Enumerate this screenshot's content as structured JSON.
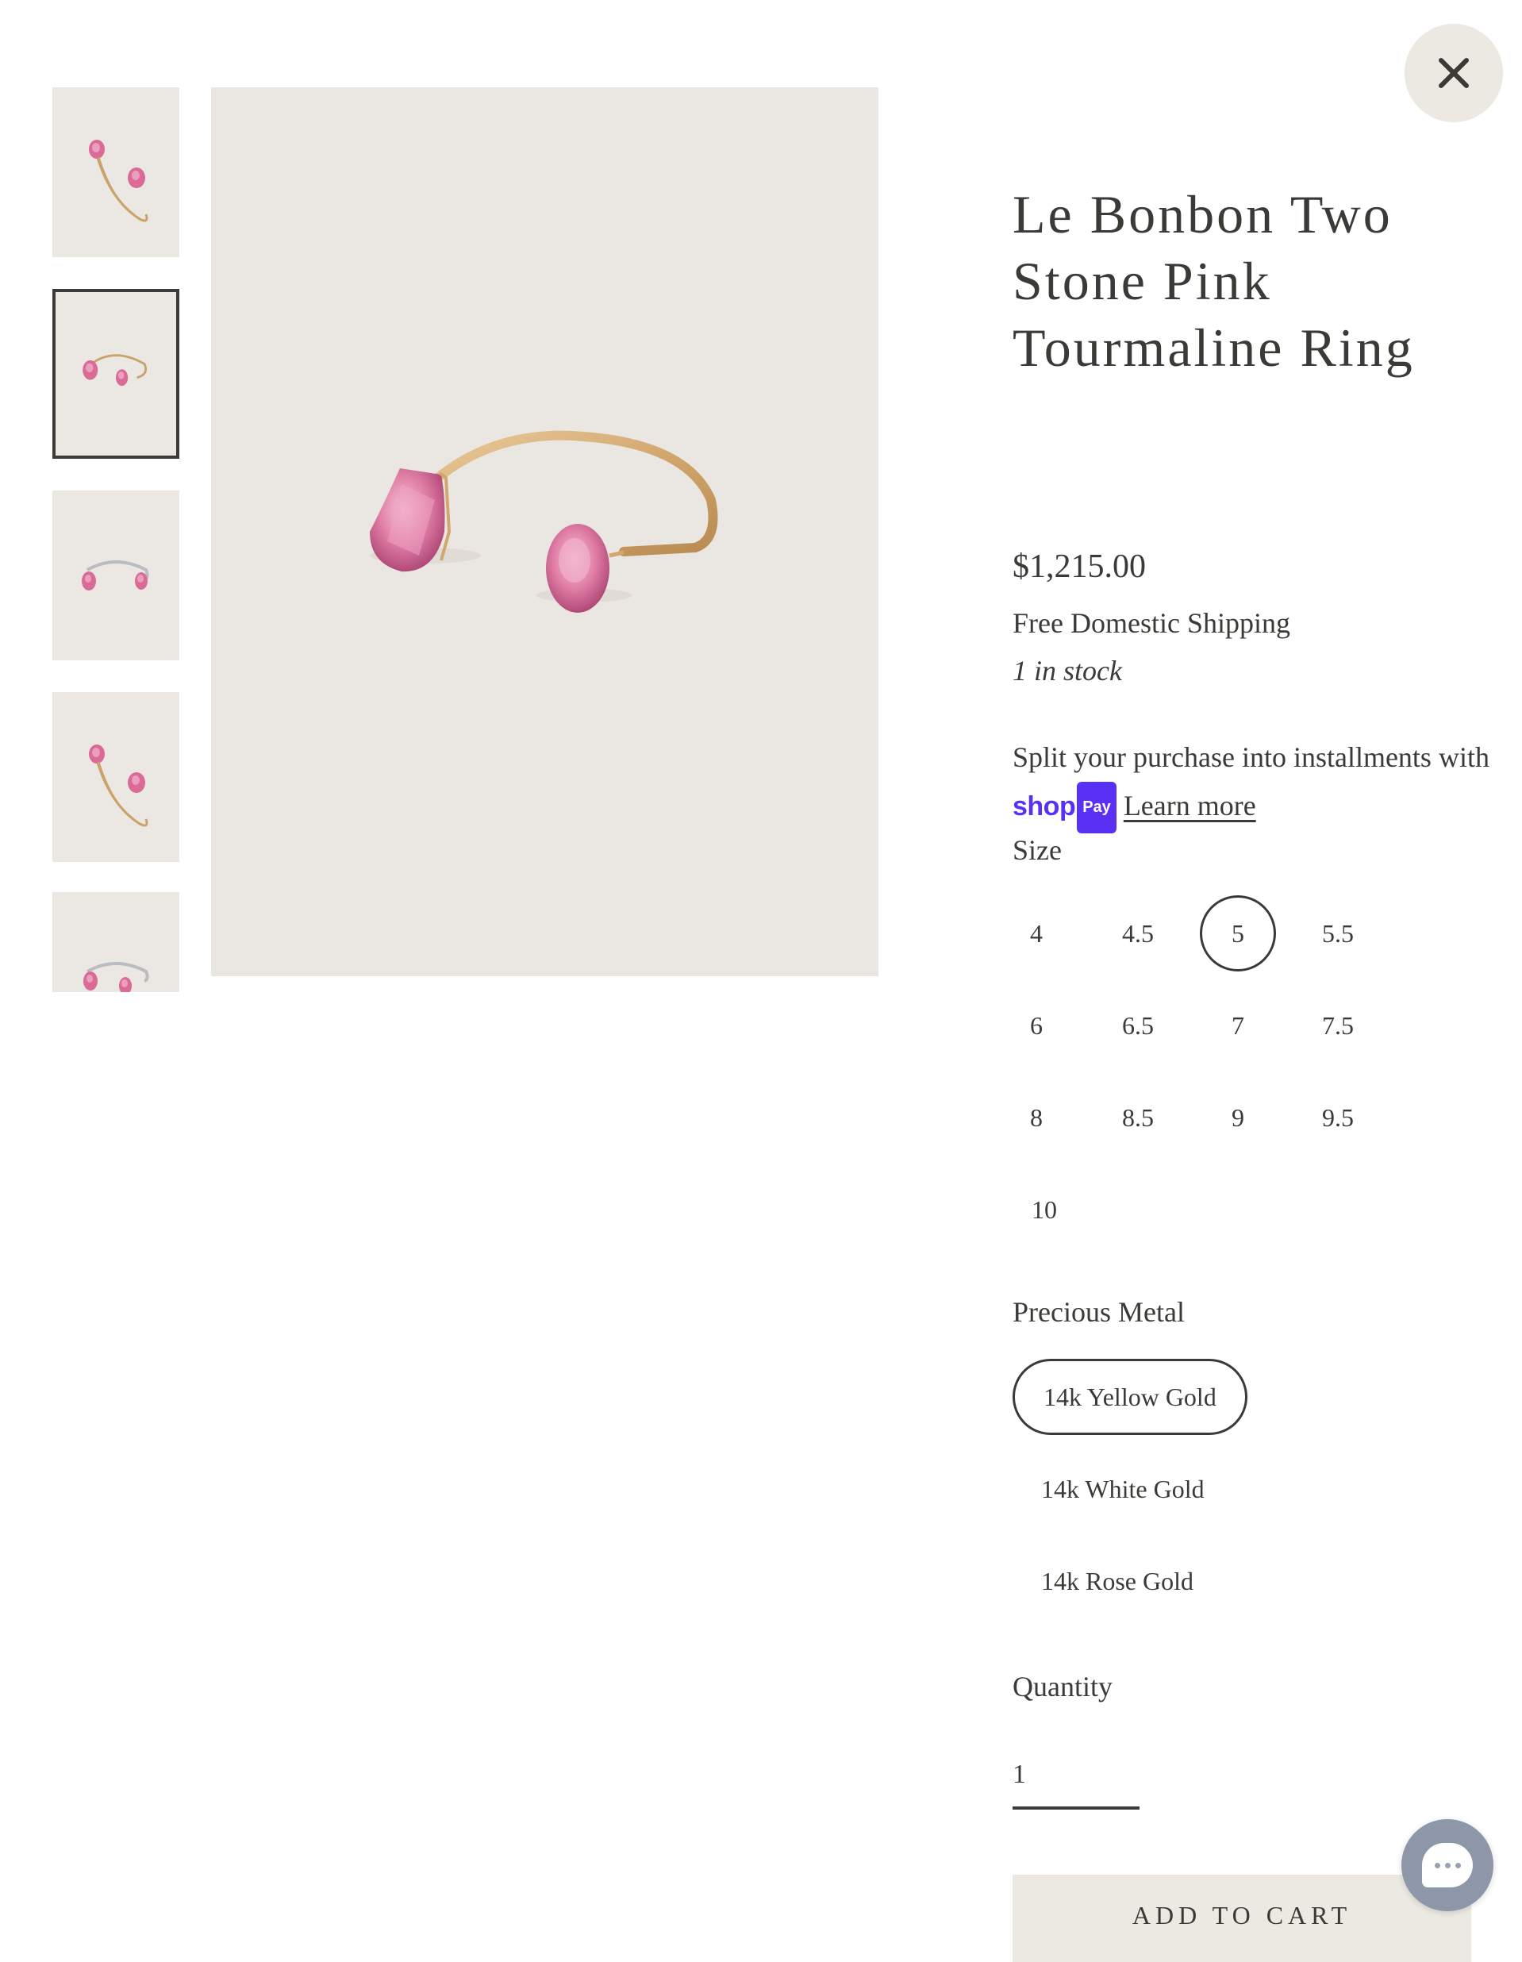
{
  "modal": {
    "close_icon": "close-x-icon"
  },
  "gallery": {
    "thumbnails": [
      {
        "name": "thumbnail-1",
        "metal": "yellow",
        "view": "side",
        "selected": false
      },
      {
        "name": "thumbnail-2",
        "metal": "yellow",
        "view": "front",
        "selected": true
      },
      {
        "name": "thumbnail-3",
        "metal": "white",
        "view": "front",
        "selected": false
      },
      {
        "name": "thumbnail-4",
        "metal": "yellow",
        "view": "side",
        "selected": false
      },
      {
        "name": "thumbnail-5",
        "metal": "white",
        "view": "front",
        "selected": false
      }
    ],
    "main_image": "ring-photo"
  },
  "product": {
    "title": "Le Bonbon Two Stone Pink Tourmaline Ring",
    "price": "$1,215.00",
    "shipping": "Free Domestic Shipping",
    "stock": "1 in stock",
    "installments_text": "Split your purchase into installments with",
    "shop_pay_brand": "shop",
    "shop_pay_badge": "Pay",
    "learn_more": "Learn more"
  },
  "size": {
    "label": "Size",
    "options": [
      "4",
      "4.5",
      "5",
      "5.5",
      "6",
      "6.5",
      "7",
      "7.5",
      "8",
      "8.5",
      "9",
      "9.5",
      "10"
    ],
    "selected": "5"
  },
  "metal": {
    "label": "Precious Metal",
    "options": [
      "14k Yellow Gold",
      "14k White Gold",
      "14k Rose Gold"
    ],
    "selected": "14k Yellow Gold"
  },
  "quantity": {
    "label": "Quantity",
    "value": "1"
  },
  "cart": {
    "add_label": "ADD TO CART"
  },
  "chat": {
    "icon": "chat-icon"
  },
  "colors": {
    "text": "#3c3a36",
    "image_bg": "#eae7e2",
    "button_bg": "#ece8e2",
    "shop_pay": "#5a31f4",
    "chat": "#8e97a8"
  }
}
